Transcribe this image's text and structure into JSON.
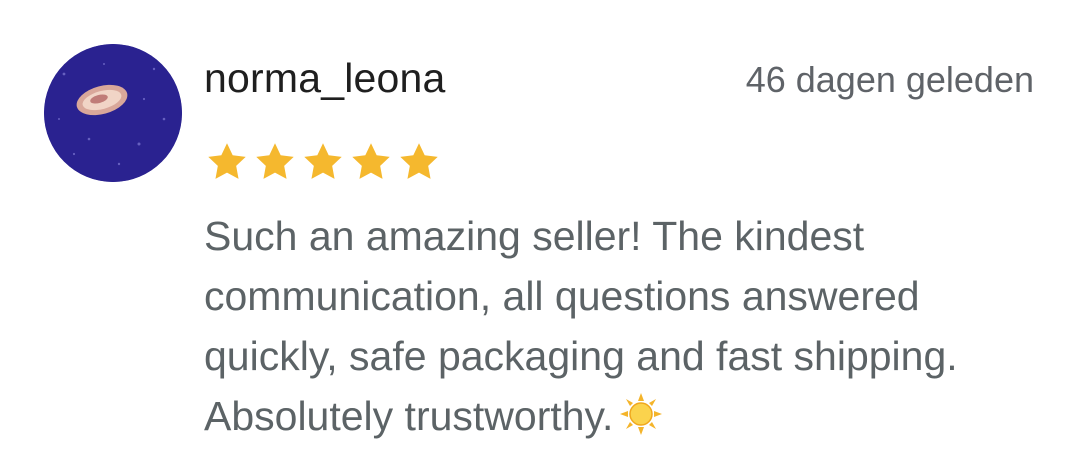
{
  "review": {
    "username": "norma_leona",
    "timestamp": "46 dagen geleden",
    "rating": 5,
    "rating_max": 5,
    "text": "Such an amazing seller! The kindest communication, all questions answered quickly, safe packaging and fast shipping. Absolutely trustworthy.",
    "emoji_icon": "sun-icon"
  },
  "colors": {
    "star": "#f5b82e",
    "username": "#1f1f1f",
    "muted_text": "#5c6366",
    "avatar_bg": "#2a2290"
  }
}
